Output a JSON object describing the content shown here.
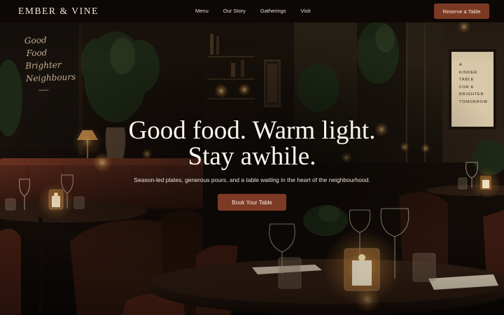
{
  "brand": {
    "name": "EMBER & VINE"
  },
  "nav": {
    "links": [
      "Menu",
      "Our Story",
      "Gatherings",
      "Visit"
    ],
    "cta_label": "Reserve a Table"
  },
  "hero": {
    "title_line1": "Good food. Warm light.",
    "title_line2": "Stay awhile.",
    "subtitle": "Season-led plates, generous pours, and a table waiting in the heart of the neighbourhood.",
    "cta_label": "Book Your Table"
  },
  "wall_art": {
    "chalkboard_lines": [
      "Good",
      "Food",
      "Brighter",
      "Neighbours"
    ],
    "poster_lines": [
      "A",
      "KINDER",
      "TABLE",
      "FOR A",
      "BRIGHTER",
      "TOMORROW"
    ]
  },
  "colors": {
    "accent": "#7c3a24",
    "background": "#0c0806",
    "text": "#f3ece4",
    "candle_glow": "#f2b25a"
  }
}
